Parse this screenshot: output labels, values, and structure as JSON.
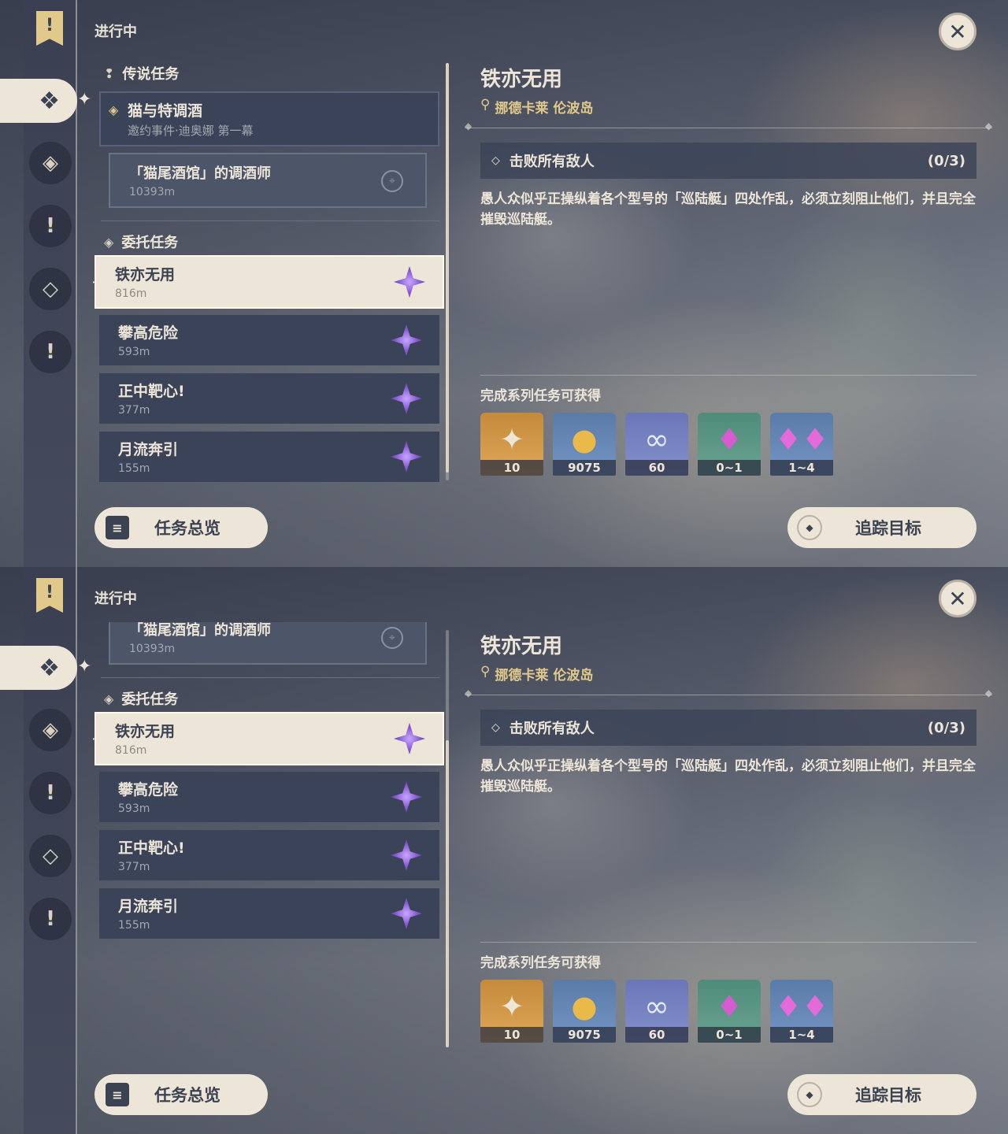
{
  "status_label": "进行中",
  "sections": {
    "legend_title": "传说任务",
    "commission_title": "委托任务"
  },
  "legend_quest": {
    "title": "猫与特调酒",
    "subtitle": "邀约事件·迪奥娜 第一幕"
  },
  "legend_subquest": {
    "title": "「猫尾酒馆」的调酒师",
    "distance": "10393m"
  },
  "quests": [
    {
      "title": "铁亦无用",
      "distance": "816m"
    },
    {
      "title": "攀高危险",
      "distance": "593m"
    },
    {
      "title": "正中靶心!",
      "distance": "377m"
    },
    {
      "title": "月流奔引",
      "distance": "155m"
    }
  ],
  "detail": {
    "title": "铁亦无用",
    "location": "挪德卡莱 伦波岛",
    "objective": "击败所有敌人",
    "objective_count": "(0/3)",
    "description": "愚人众似乎正操纵着各个型号的「巡陆艇」四处作乱，必须立刻阻止他们，并且完全摧毁巡陆艇。",
    "rewards_title": "完成系列任务可获得"
  },
  "rewards": [
    {
      "icon": "primogem-icon",
      "count": "10",
      "color": "#c58a3b"
    },
    {
      "icon": "mora-icon",
      "count": "9075",
      "color": "#5a7ba8"
    },
    {
      "icon": "exp-icon",
      "count": "60",
      "color": "#6a76b8"
    },
    {
      "icon": "crystal-icon",
      "count": "0~1",
      "color": "#4f8b7a"
    },
    {
      "icon": "crystal-cluster-icon",
      "count": "1~4",
      "color": "#5a7ba8"
    }
  ],
  "buttons": {
    "overview": "任务总览",
    "track": "追踪目标"
  }
}
